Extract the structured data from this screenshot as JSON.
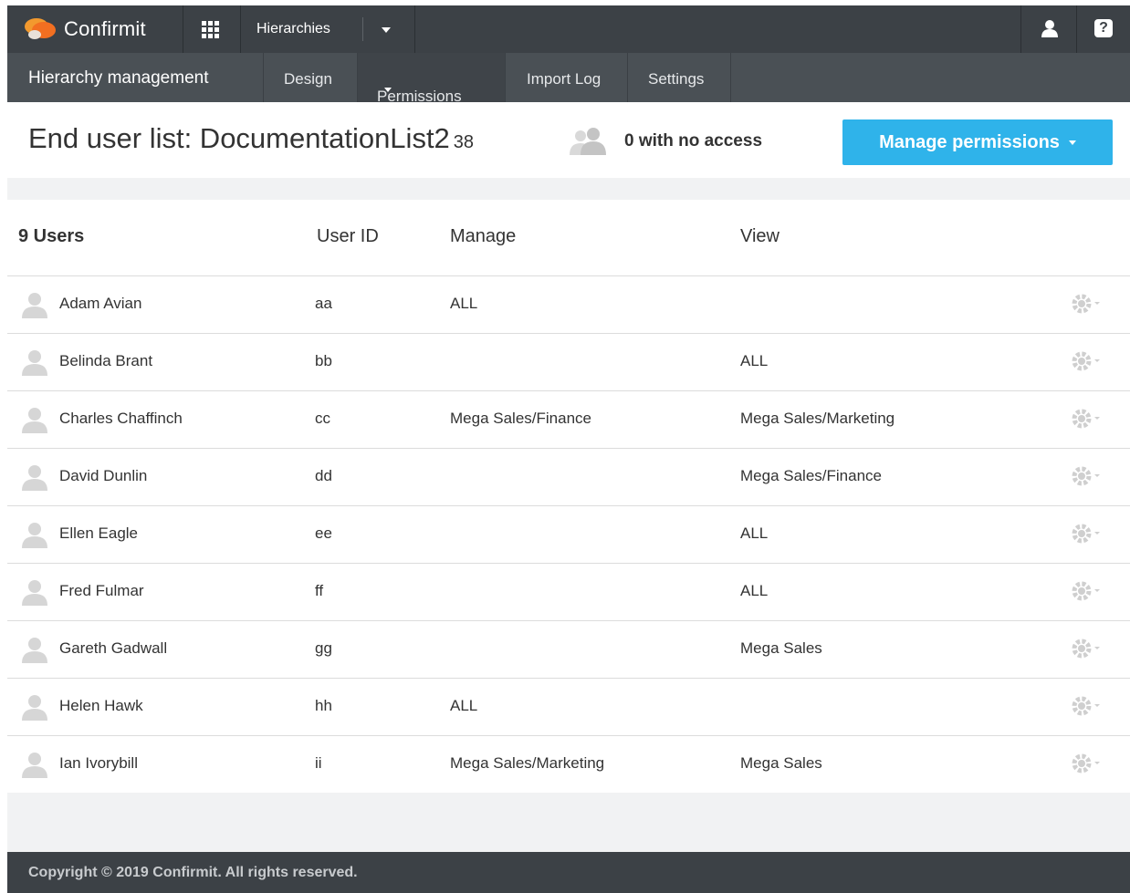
{
  "topbar": {
    "brand": "Confirmit",
    "app_name": "Hierarchies"
  },
  "subnav": {
    "title": "Hierarchy management",
    "tabs": [
      {
        "label": "Design"
      },
      {
        "label": "Permissions"
      },
      {
        "label": "Import Log"
      },
      {
        "label": "Settings"
      }
    ]
  },
  "header": {
    "title": "End user list: DocumentationList2",
    "count": "38",
    "no_access": "0 with no access",
    "manage_button": "Manage permissions"
  },
  "table": {
    "columns": {
      "users": "9 Users",
      "user_id": "User ID",
      "manage": "Manage",
      "view": "View"
    },
    "rows": [
      {
        "name": "Adam Avian",
        "user_id": "aa",
        "manage": "ALL",
        "view": ""
      },
      {
        "name": "Belinda Brant",
        "user_id": "bb",
        "manage": "",
        "view": "ALL"
      },
      {
        "name": "Charles Chaffinch",
        "user_id": "cc",
        "manage": "Mega Sales/Finance",
        "view": "Mega Sales/Marketing"
      },
      {
        "name": "David Dunlin",
        "user_id": "dd",
        "manage": "",
        "view": "Mega Sales/Finance"
      },
      {
        "name": "Ellen Eagle",
        "user_id": "ee",
        "manage": "",
        "view": "ALL"
      },
      {
        "name": "Fred Fulmar",
        "user_id": "ff",
        "manage": "",
        "view": "ALL"
      },
      {
        "name": "Gareth Gadwall",
        "user_id": "gg",
        "manage": "",
        "view": "Mega Sales"
      },
      {
        "name": "Helen Hawk",
        "user_id": "hh",
        "manage": "ALL",
        "view": ""
      },
      {
        "name": "Ian Ivorybill",
        "user_id": "ii",
        "manage": "Mega Sales/Marketing",
        "view": "Mega Sales"
      }
    ]
  },
  "footer": {
    "copyright": "Copyright © 2019 Confirmit. All rights reserved."
  },
  "colors": {
    "topbar": "#3c4146",
    "subnav": "#4a5055",
    "accent": "#2fb3ea",
    "brand_orange": "#f26f21"
  }
}
